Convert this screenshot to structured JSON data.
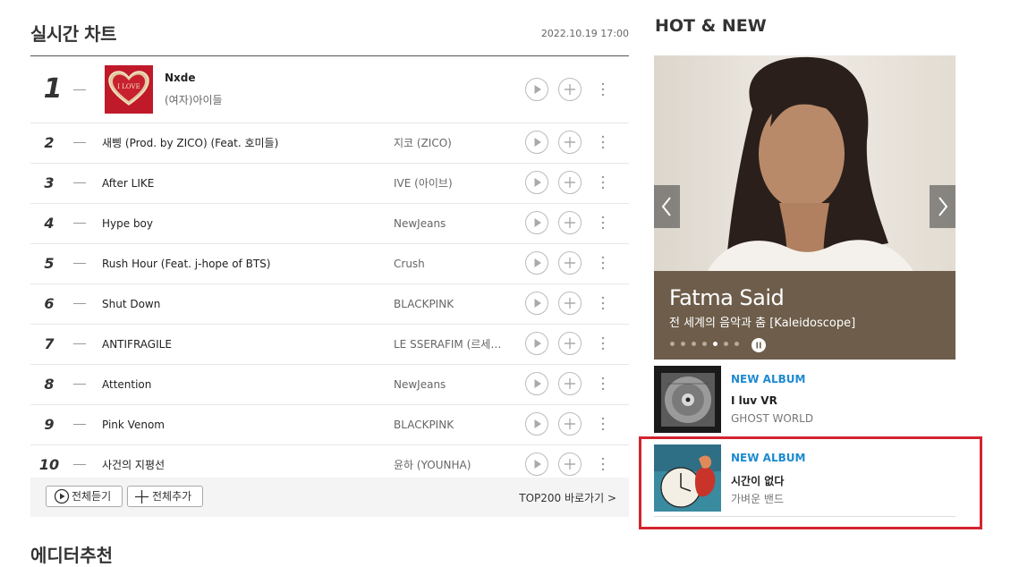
{
  "chart": {
    "title": "실시간 차트",
    "date": "2022.10.19 17:00",
    "rows": [
      {
        "rank": "1",
        "title": "Nxde",
        "artist": "(여자)아이들"
      },
      {
        "rank": "2",
        "title": "새삥 (Prod. by ZICO) (Feat. 호미들)",
        "artist": "지코 (ZICO)"
      },
      {
        "rank": "3",
        "title": "After LIKE",
        "artist": "IVE (아이브)"
      },
      {
        "rank": "4",
        "title": "Hype boy",
        "artist": "NewJeans"
      },
      {
        "rank": "5",
        "title": "Rush Hour (Feat. j-hope of BTS)",
        "artist": "Crush"
      },
      {
        "rank": "6",
        "title": "Shut Down",
        "artist": "BLACKPINK"
      },
      {
        "rank": "7",
        "title": "ANTIFRAGILE",
        "artist": "LE SSERAFIM (르세…"
      },
      {
        "rank": "8",
        "title": "Attention",
        "artist": "NewJeans"
      },
      {
        "rank": "9",
        "title": "Pink Venom",
        "artist": "BLACKPINK"
      },
      {
        "rank": "10",
        "title": "사건의 지평선",
        "artist": "윤하 (YOUNHA)"
      }
    ],
    "cover1_text": "I LOVE",
    "footer": {
      "play_all": "전체듣기",
      "add_all": "전체추가",
      "top200": "TOP200 바로가기 >"
    }
  },
  "editor_title": "에디터추천",
  "hot_new": {
    "title": "HOT & NEW",
    "banner": {
      "name": "Fatma Said",
      "subtitle": "전 세계의 음악과 춤 [Kaleidoscope]",
      "slides": 7,
      "active_slide": 5
    },
    "albums": [
      {
        "tag": "NEW ALBUM",
        "title": "I luv VR",
        "artist": "GHOST WORLD"
      },
      {
        "tag": "NEW ALBUM",
        "title": "시간이 없다",
        "artist": "가벼운 밴드"
      }
    ]
  },
  "colors": {
    "accent_blue": "#1d8ad1",
    "banner_caption": "#6d5d4a",
    "highlight_red": "#d3242f"
  }
}
